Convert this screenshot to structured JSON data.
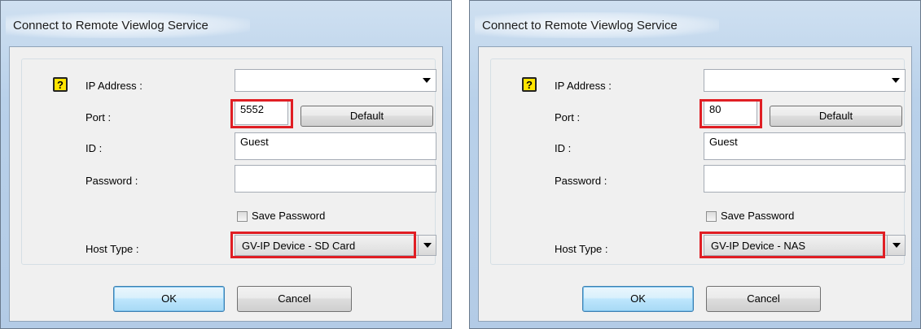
{
  "dialogs": [
    {
      "title": "Connect to Remote Viewlog Service",
      "help_glyph": "?",
      "ip_label": "IP Address :",
      "ip_value": "",
      "port_label": "Port :",
      "port_value": "5552",
      "default_label": "Default",
      "id_label": "ID :",
      "id_value": "Guest",
      "password_label": "Password :",
      "password_value": "",
      "save_password_label": "Save Password",
      "save_password_checked": false,
      "host_type_label": "Host Type :",
      "host_type_value": "GV-IP Device - SD Card",
      "ok_label": "OK",
      "cancel_label": "Cancel"
    },
    {
      "title": "Connect to Remote Viewlog Service",
      "help_glyph": "?",
      "ip_label": "IP Address :",
      "ip_value": "",
      "port_label": "Port :",
      "port_value": "80",
      "default_label": "Default",
      "id_label": "ID :",
      "id_value": "Guest",
      "password_label": "Password :",
      "password_value": "",
      "save_password_label": "Save Password",
      "save_password_checked": false,
      "host_type_label": "Host Type :",
      "host_type_value": "GV-IP Device - NAS",
      "ok_label": "OK",
      "cancel_label": "Cancel"
    }
  ],
  "colors": {
    "highlight": "#e01e24",
    "help_icon": "#ffe400",
    "ok_button": "#bee6fd"
  },
  "icons": {
    "help": "help-icon",
    "dropdown": "chevron-down-icon"
  }
}
